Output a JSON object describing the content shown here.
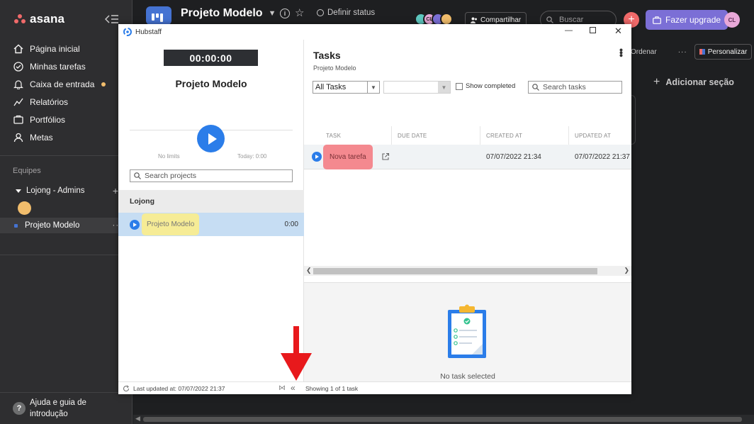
{
  "asana": {
    "logo": "asana",
    "nav": [
      {
        "label": "Página inicial",
        "icon": "home-icon"
      },
      {
        "label": "Minhas tarefas",
        "icon": "check-circle-icon"
      },
      {
        "label": "Caixa de entrada",
        "icon": "bell-icon"
      },
      {
        "label": "Relatórios",
        "icon": "chart-line-icon"
      },
      {
        "label": "Portfólios",
        "icon": "folder-icon"
      },
      {
        "label": "Metas",
        "icon": "person-icon"
      }
    ],
    "teams_label": "Equipes",
    "team_name": "Lojong - Admins",
    "project_name": "Projeto Modelo",
    "help_line1": "Ajuda e guia de",
    "help_line2": "introdução",
    "topbar": {
      "title": "Projeto Modelo",
      "status": "Definir status",
      "share": "Compartilhar",
      "search_placeholder": "Buscar",
      "upgrade": "Fazer upgrade",
      "user_initials": "CL",
      "collab_initials": "CL"
    },
    "toolbar": {
      "sort": "Ordenar",
      "customize": "Personalizar"
    },
    "add_section": "Adicionar seção",
    "colors": {
      "brand": "#f06a6a",
      "upgrade": "#7b6fd6",
      "project": "#4573d2"
    }
  },
  "hubstaff": {
    "window_title": "Hubstaff",
    "timer": "00:00:00",
    "current_project": "Projeto Modelo",
    "no_limits": "No limits",
    "today": "Today: 0:00",
    "search_projects_placeholder": "Search projects",
    "organization": "Lojong",
    "project": {
      "name": "Projeto Modelo",
      "time": "0:00"
    },
    "tasks_title": "Tasks",
    "tasks_subtitle": "Projeto Modelo",
    "filter_selected": "All Tasks",
    "show_completed": "Show completed",
    "search_tasks_placeholder": "Search tasks",
    "columns": [
      "TASK",
      "DUE DATE",
      "CREATED AT",
      "UPDATED AT"
    ],
    "rows": [
      {
        "task": "Nova tarefa",
        "due": "",
        "created": "07/07/2022 21:34",
        "updated": "07/07/2022 21:37"
      }
    ],
    "no_task_selected": "No task selected",
    "last_updated": "Last updated at: 07/07/2022 21:37",
    "showing": "Showing 1 of 1 task",
    "colors": {
      "accent": "#2b7de9",
      "highlight_yellow": "#f6ec96",
      "highlight_red": "#f4898f"
    }
  }
}
